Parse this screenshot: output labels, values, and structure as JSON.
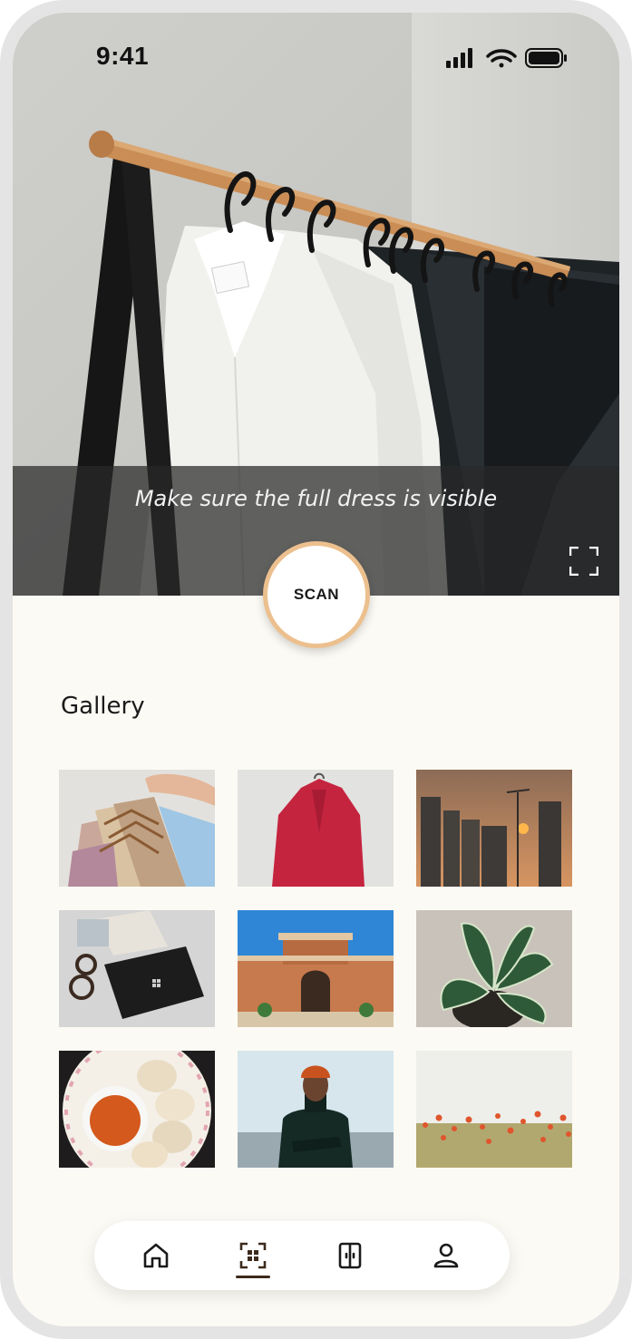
{
  "status_bar": {
    "time": "9:41",
    "icons": [
      "signal-icon",
      "wifi-icon",
      "battery-icon"
    ]
  },
  "camera": {
    "hint": "Make sure the full dress is visible",
    "expand_icon": "expand-frame-icon",
    "scan_label": "SCAN"
  },
  "gallery": {
    "title": "Gallery",
    "images": [
      "clothes-on-hangers-photo",
      "red-blazer-photo",
      "city-sunset-photo",
      "laptop-and-map-photo",
      "palace-architecture-photo",
      "potted-plant-photo",
      "idli-sambar-plate-photo",
      "man-in-turtleneck-photo",
      "poppy-field-photo"
    ]
  },
  "nav": {
    "items": [
      "home-icon",
      "scan-icon",
      "wardrobe-icon",
      "profile-icon"
    ],
    "active": "scan-icon"
  },
  "colors": {
    "background": "#fcfaf4",
    "scan_ring": "#ecc08e",
    "active_underline": "#3c2a1c"
  }
}
